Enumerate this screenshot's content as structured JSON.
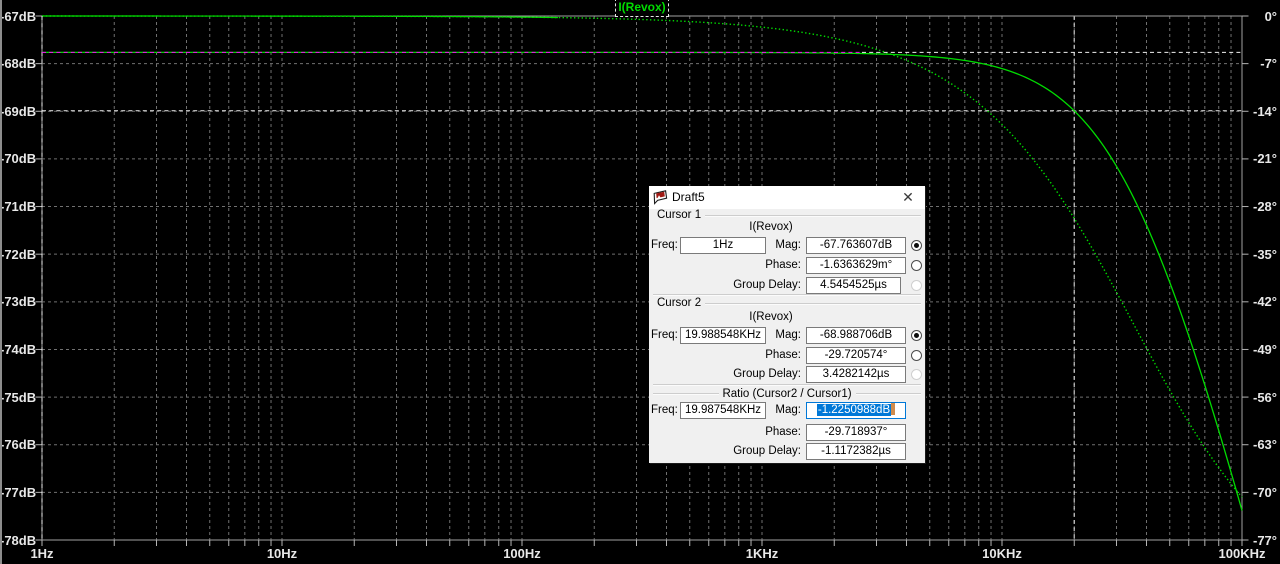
{
  "colors": {
    "background": "#000000",
    "trace_green": "#00dc00",
    "grid_gray": "#717171",
    "pane_border": "#a2a2a2",
    "tick": "#b4b4b4",
    "axis_text": "#e8e8e8",
    "cursor_line": "#f0f0f0",
    "cursor_xor_magenta": "#ff00ff",
    "selection_blue": "#0078d7",
    "dialog_body": "#f0f0f0",
    "dialog_titlebar": "#ffffff"
  },
  "trace_label": "I(Revox)",
  "chart_data": {
    "type": "line",
    "title": "",
    "x_axis": {
      "scale": "log",
      "unit": "Hz",
      "min_hz": 1,
      "max_hz": 100000,
      "tick_labels": [
        "1Hz",
        "10Hz",
        "100Hz",
        "1KHz",
        "10KHz",
        "100KHz"
      ]
    },
    "y_left_axis": {
      "unit": "dB",
      "top_db": -67,
      "bottom_db": -78,
      "step_db": 1,
      "tick_labels": [
        "-67dB",
        "-68dB",
        "-69dB",
        "-70dB",
        "-71dB",
        "-72dB",
        "-73dB",
        "-74dB",
        "-75dB",
        "-76dB",
        "-77dB",
        "-78dB"
      ]
    },
    "y_right_axis": {
      "unit": "deg",
      "top_deg": 0,
      "bottom_deg": -77,
      "step_deg": 7,
      "tick_labels": [
        "0°",
        "-7°",
        "-14°",
        "-21°",
        "-28°",
        "-35°",
        "-42°",
        "-49°",
        "-56°",
        "-63°",
        "-70°",
        "-77°"
      ]
    },
    "series": [
      {
        "name": "I(Revox) magnitude",
        "style": "solid",
        "axis": "left",
        "model": "single_pole_lowpass",
        "dc_level_db": -67.763607,
        "pole_hz": 35012
      },
      {
        "name": "I(Revox) phase",
        "style": "dotted",
        "axis": "right",
        "model": "single_pole_lowpass_phase",
        "pole_hz": 35012
      }
    ],
    "cursors": [
      {
        "name": "cursor1",
        "freq_hz": 1,
        "mag_db": -67.763607
      },
      {
        "name": "cursor2",
        "freq_hz": 19988.548,
        "mag_db": -68.988706
      }
    ],
    "legend_position": "top-center",
    "grid": true
  },
  "dialog": {
    "title": "Draft5",
    "close_glyph": "✕",
    "freq_label": "Freq:",
    "mag_label": "Mag:",
    "phase_label": "Phase:",
    "group_delay_label": "Group Delay:",
    "cursor1": {
      "heading": "Cursor 1",
      "trace": "I(Revox)",
      "freq": "1Hz",
      "mag": "-67.763607dB",
      "phase": "-1.6363629m°",
      "group_delay": "4.5454525µs",
      "mag_radio": "selected",
      "phase_radio": "unselected",
      "group_delay_radio": "disabled"
    },
    "cursor2": {
      "heading": "Cursor 2",
      "trace": "I(Revox)",
      "freq": "19.988548KHz",
      "mag": "-68.988706dB",
      "phase": "-29.720574°",
      "group_delay": "3.4282142µs",
      "mag_radio": "selected",
      "phase_radio": "unselected",
      "group_delay_radio": "disabled"
    },
    "ratio": {
      "heading": "Ratio (Cursor2 / Cursor1)",
      "freq": "19.987548KHz",
      "mag": "-1.2250988dB",
      "mag_state": "focused-selected",
      "phase": "-29.718937°",
      "group_delay": "-1.1172382µs"
    }
  }
}
